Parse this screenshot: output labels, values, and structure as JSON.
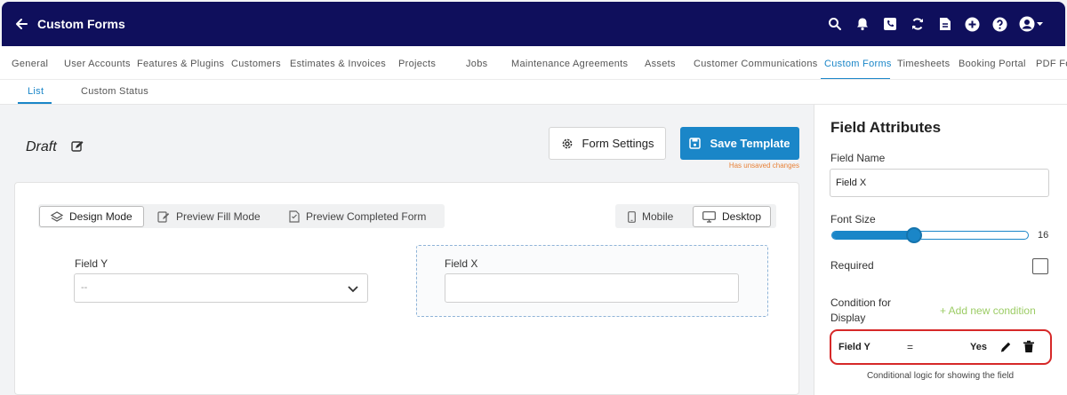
{
  "header": {
    "title": "Custom Forms",
    "icons": [
      "arrow-left-icon",
      "search-icon",
      "bell-icon",
      "phone-icon",
      "sync-icon",
      "document-icon",
      "plus-circle-icon",
      "help-icon",
      "user-icon"
    ]
  },
  "main_tabs": [
    {
      "label": "General"
    },
    {
      "label": "User Accounts"
    },
    {
      "label": "Features & Plugins"
    },
    {
      "label": "Customers"
    },
    {
      "label": "Estimates & Invoices"
    },
    {
      "label": "Projects"
    },
    {
      "label": "Jobs"
    },
    {
      "label": "Maintenance Agreements"
    },
    {
      "label": "Assets"
    },
    {
      "label": "Customer Communications"
    },
    {
      "label": "Custom Forms",
      "active": true
    },
    {
      "label": "Timesheets"
    },
    {
      "label": "Booking Portal"
    },
    {
      "label": "PDF Fo"
    }
  ],
  "sub_tabs": [
    {
      "label": "List",
      "active": true
    },
    {
      "label": "Custom Status"
    }
  ],
  "form": {
    "name": "Draft",
    "settings_label": "Form Settings",
    "save_label": "Save Template",
    "unsaved_note": "Has unsaved changes"
  },
  "modes": [
    {
      "label": "Design Mode",
      "icon": "design-icon",
      "active": true
    },
    {
      "label": "Preview Fill Mode",
      "icon": "fill-icon"
    },
    {
      "label": "Preview Completed Form",
      "icon": "completed-form-icon"
    }
  ],
  "devices": [
    {
      "label": "Mobile",
      "icon": "mobile-icon"
    },
    {
      "label": "Desktop",
      "icon": "desktop-icon",
      "active": true
    }
  ],
  "canvas": {
    "field_y": {
      "label": "Field Y",
      "value": "--"
    },
    "field_x": {
      "label": "Field X",
      "value": ""
    }
  },
  "panel": {
    "title": "Field Attributes",
    "field_name_label": "Field Name",
    "field_name_value": "Field X",
    "font_size_label": "Font Size",
    "font_size_value": "16",
    "font_size_fraction": 0.42,
    "required_label": "Required",
    "required_checked": false,
    "condition_label_1": "Condition for",
    "condition_label_2": "Display",
    "add_condition": "+ Add new condition",
    "condition": {
      "field": "Field Y",
      "operator": "=",
      "value": "Yes"
    },
    "condition_help": "Conditional logic for showing the field"
  },
  "colors": {
    "topbar": "#0f0f5c",
    "accent": "#1a86c8",
    "highlight": "#d62828",
    "add_link": "#9ccc65",
    "warning": "#e8833a"
  }
}
